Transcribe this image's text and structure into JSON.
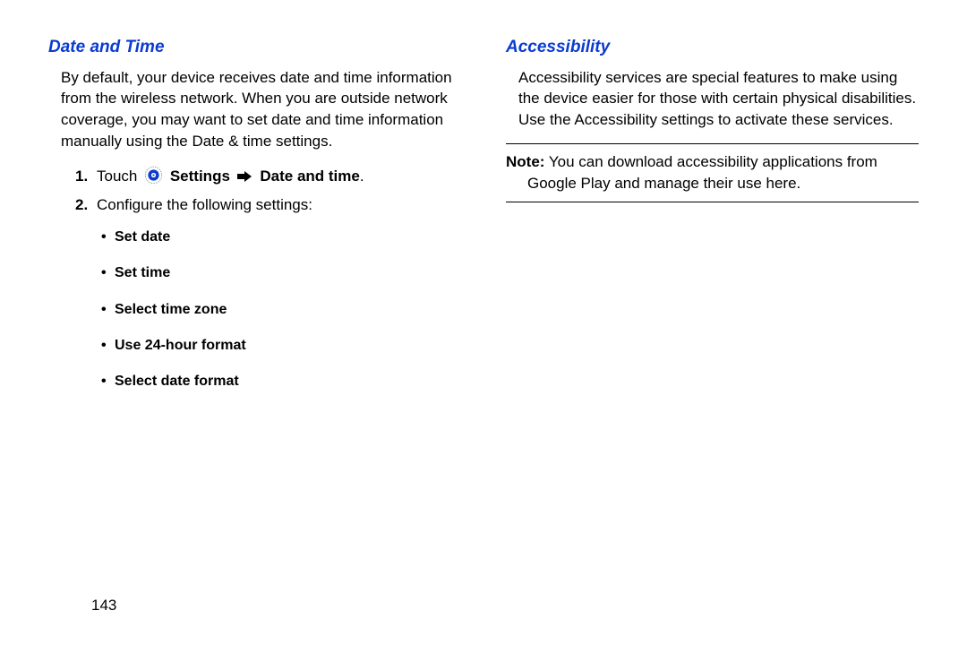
{
  "left": {
    "heading": "Date and Time",
    "intro": "By default, your device receives date and time information from the wireless network. When you are outside network coverage, you may want to set date and time information manually using the Date & time settings.",
    "step1_num": "1.",
    "step1_touch": "Touch",
    "step1_settings": "Settings",
    "step1_datetime": "Date and time",
    "step1_period": ".",
    "step2_num": "2.",
    "step2_text": "Configure the following settings:",
    "bullets": {
      "b1": "Set date",
      "b2": "Set time",
      "b3": "Select time zone",
      "b4": "Use 24-hour format",
      "b5": "Select date format"
    }
  },
  "right": {
    "heading": "Accessibility",
    "intro": "Accessibility services are special features to make using the device easier for those with certain physical disabilities. Use the Accessibility settings to activate these services.",
    "note_label": "Note:",
    "note_line1": " You can download accessibility applications from",
    "note_line2": "Google Play and manage their use here."
  },
  "page_number": "143"
}
